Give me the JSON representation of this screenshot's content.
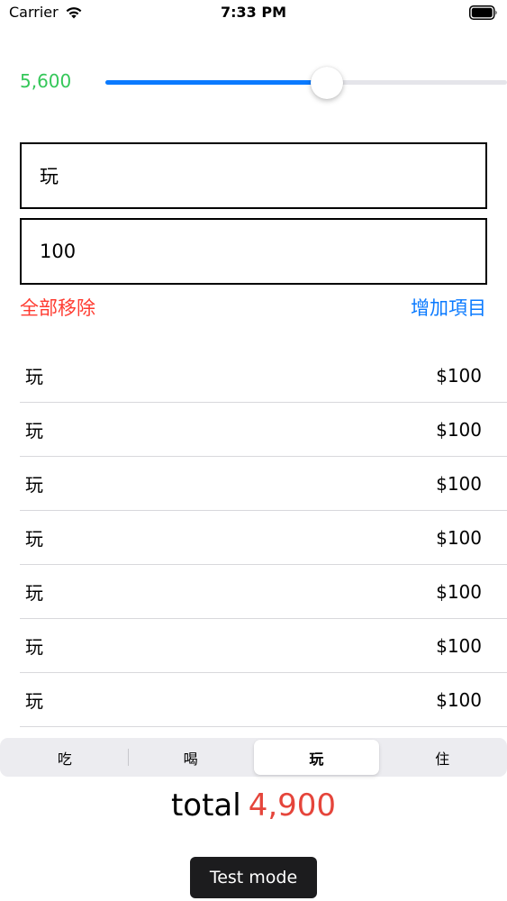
{
  "status_bar": {
    "carrier": "Carrier",
    "time": "7:33 PM",
    "wifi_icon": "wifi-icon",
    "battery_icon": "battery-icon"
  },
  "slider": {
    "display_value": "5,600",
    "fraction": 0.551,
    "value_color": "#34c759",
    "fill_color": "#0a7aff"
  },
  "form": {
    "name_value": "玩",
    "amount_value": "100"
  },
  "actions": {
    "remove_all_label": "全部移除",
    "add_item_label": "增加項目",
    "remove_color": "#ff3b30",
    "add_color": "#0a7aff"
  },
  "items": [
    {
      "name": "玩",
      "price": "$100"
    },
    {
      "name": "玩",
      "price": "$100"
    },
    {
      "name": "玩",
      "price": "$100"
    },
    {
      "name": "玩",
      "price": "$100"
    },
    {
      "name": "玩",
      "price": "$100"
    },
    {
      "name": "玩",
      "price": "$100"
    },
    {
      "name": "玩",
      "price": "$100"
    }
  ],
  "segments": [
    {
      "label": "吃",
      "selected": false
    },
    {
      "label": "喝",
      "selected": false
    },
    {
      "label": "玩",
      "selected": true
    },
    {
      "label": "住",
      "selected": false
    }
  ],
  "total": {
    "label": "total",
    "value": "4,900",
    "value_color": "#e5453b"
  },
  "toast": {
    "text": "Test mode"
  }
}
